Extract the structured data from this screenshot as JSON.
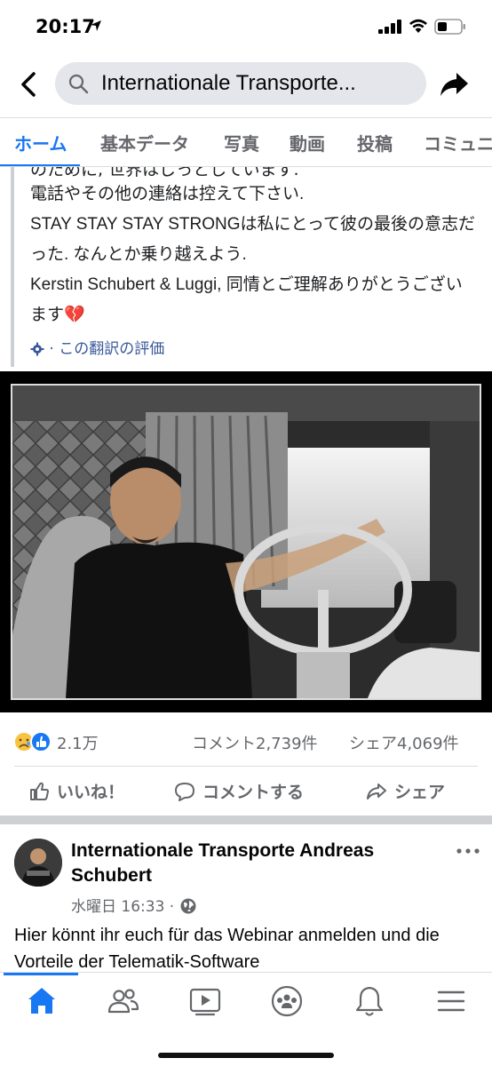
{
  "status_bar": {
    "time": "20:17"
  },
  "header": {
    "search_text": "Internationale Transporte..."
  },
  "tabs": [
    {
      "label": "ホーム",
      "active": true
    },
    {
      "label": "基本データ"
    },
    {
      "label": "写真"
    },
    {
      "label": "動画"
    },
    {
      "label": "投稿"
    },
    {
      "label": "コミュニ"
    }
  ],
  "post": {
    "cut_line": "のために, 世界はじっとしています.",
    "lines": [
      "電話やその他の連絡は控えて下さい.",
      "STAY STAY STAY STRONGは私にとって彼の最後の意志だった. なんとか乗り越えよう.",
      "Kerstin Schubert & Luggi, 同情とご理解ありがとうございます💔"
    ],
    "rate_translation": "· この翻訳の評価",
    "reaction_count": "2.1万",
    "comment_count": "コメント2,739件",
    "share_count": "シェア4,069件",
    "actions": {
      "like": "いいね！",
      "comment": "コメントする",
      "share": "シェア"
    }
  },
  "post2": {
    "page_name": "Internationale Transporte Andreas Schubert",
    "meta_time": "水曜日 16:33 ·",
    "text": "Hier könnt ihr euch für das Webinar anmelden und die Vorteile der Telematik-Software"
  },
  "icons": {
    "accent": "#1877f2",
    "link": "#385898",
    "muted": "#65676b"
  }
}
